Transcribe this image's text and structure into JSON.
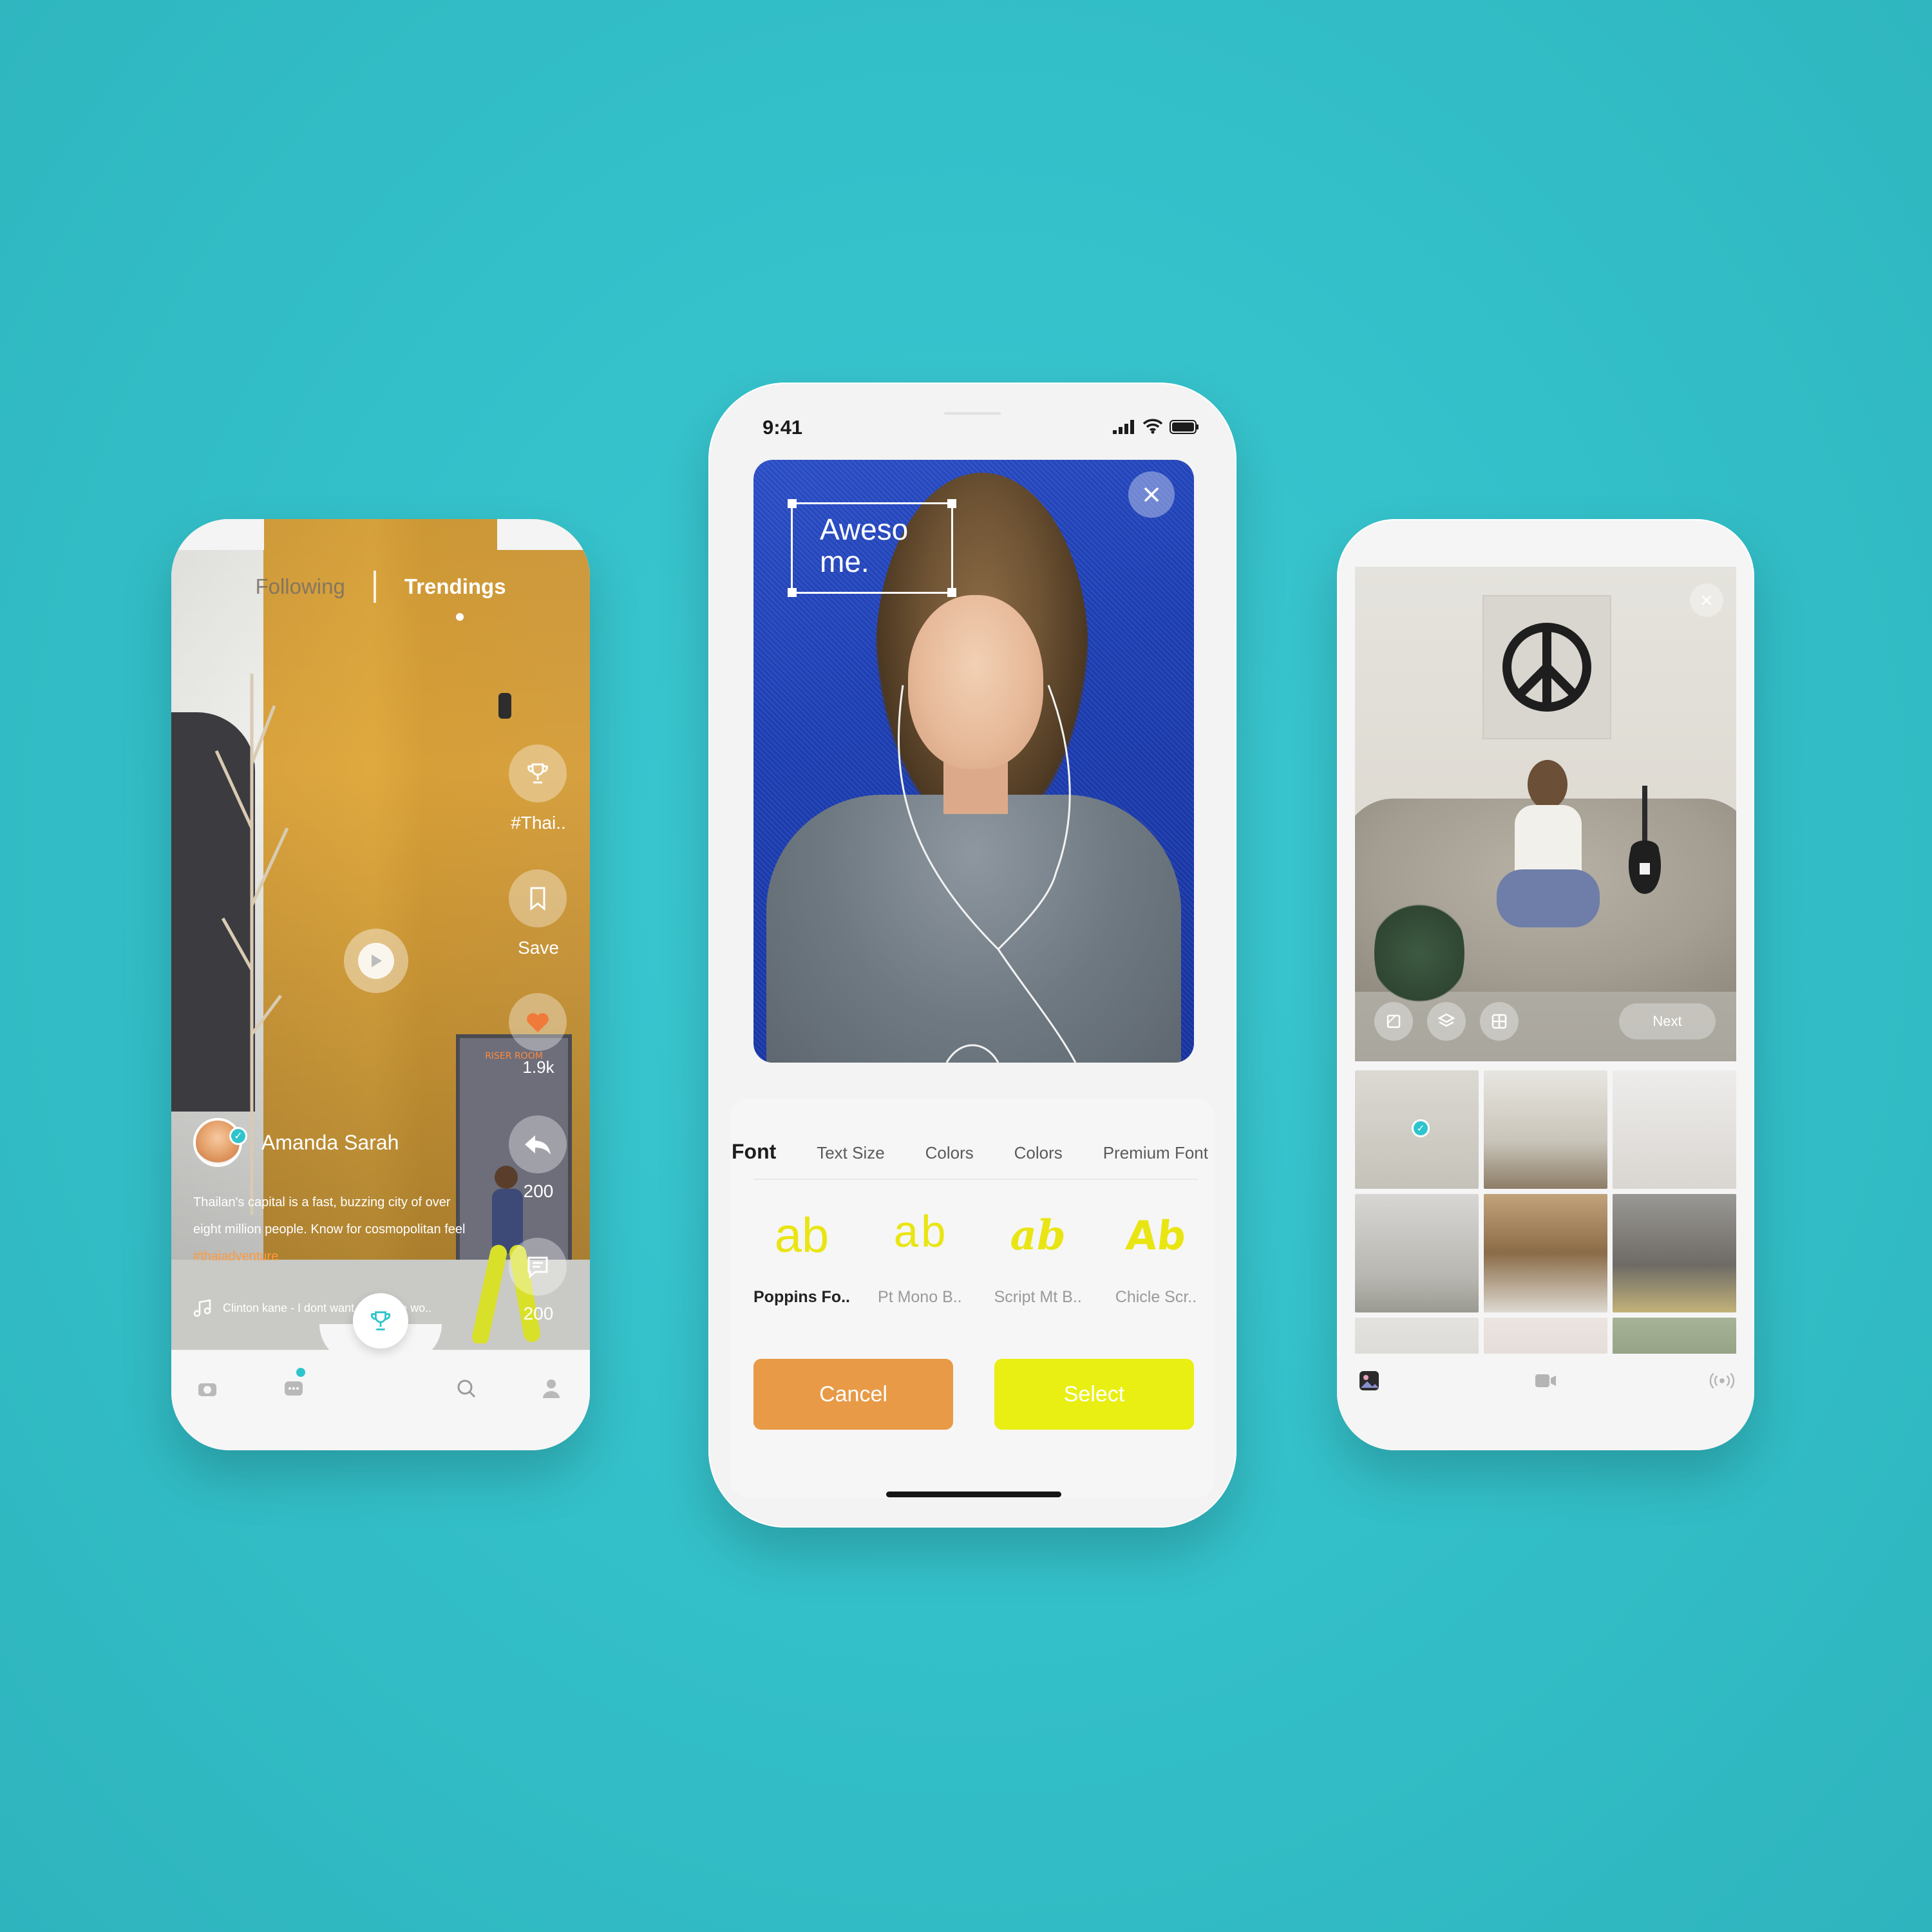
{
  "colors": {
    "background": "#34c2cb",
    "accent_teal": "#2ec4cc",
    "cancel_orange": "#e89a46",
    "select_yellow": "#e9ef13",
    "hashtag_orange": "#ff9a3d"
  },
  "left_phone": {
    "tabs": [
      "Following",
      "Trendings"
    ],
    "active_tab": "Trendings",
    "actions": [
      {
        "icon": "trophy-icon",
        "label": "#Thai.."
      },
      {
        "icon": "bookmark-icon",
        "label": "Save"
      },
      {
        "icon": "heart-icon",
        "label": "1.9k"
      },
      {
        "icon": "share-icon",
        "label": "200"
      },
      {
        "icon": "comment-icon",
        "label": "200"
      }
    ],
    "door_sign": "RISER ROOM",
    "username": "Amanda Sarah",
    "caption": "Thailan's capital is a fast, buzzing city of over eight million people. Know for cosmopolitan feel",
    "hashtag": "#thaiadventure",
    "music": "Clinton kane - I dont want watch the wo..",
    "nav_icons": [
      "camera-icon",
      "chat-icon",
      "trophy-icon",
      "search-icon",
      "profile-icon"
    ]
  },
  "center_phone": {
    "status_time": "9:41",
    "overlay_text_line1": "Aweso",
    "overlay_text_line2": "me.",
    "tabs": [
      "Font",
      "Text Size",
      "Colors",
      "Colors",
      "Premium Font"
    ],
    "active_tab": "Font",
    "fonts": [
      {
        "sample": "ab",
        "name": "Poppins Fo.."
      },
      {
        "sample": "ab",
        "name": "Pt Mono B.."
      },
      {
        "sample": "ab",
        "name": "Script Mt B.."
      },
      {
        "sample": "Ab",
        "name": "Chicle Scr.."
      }
    ],
    "cancel_label": "Cancel",
    "select_label": "Select"
  },
  "right_phone": {
    "next_label": "Next",
    "tools": [
      "crop-icon",
      "layers-icon",
      "grid-icon"
    ],
    "thumbnails": [
      {
        "color": "#cfccc4",
        "selected": true
      },
      {
        "color": "#d8d4cb"
      },
      {
        "color": "#dedbd5"
      },
      {
        "color": "#c9c8c3"
      },
      {
        "color": "#a98f6c"
      },
      {
        "color": "#8c8a86"
      },
      {
        "color": "#d6d3cf"
      },
      {
        "color": "#e2dcd8"
      },
      {
        "color": "#7f8c70"
      }
    ],
    "nav_icons": [
      "gallery-icon",
      "video-icon",
      "live-icon"
    ]
  }
}
